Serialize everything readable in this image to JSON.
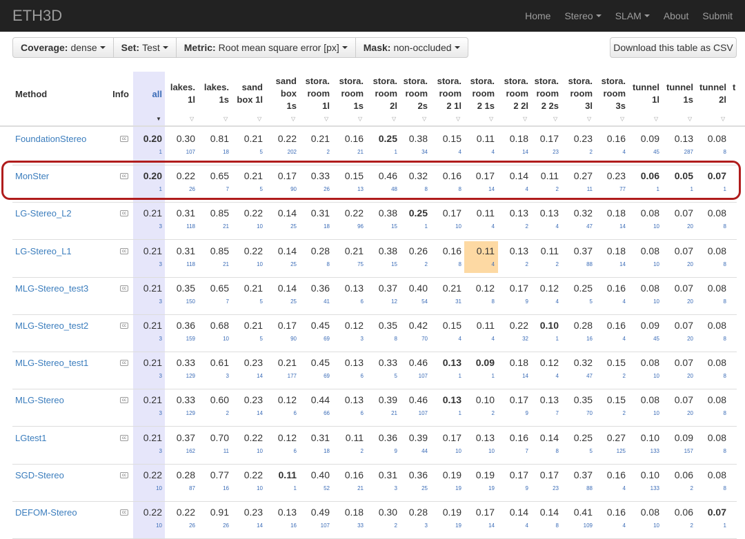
{
  "app": {
    "brand": "ETH3D"
  },
  "nav": [
    {
      "label": "Home",
      "dropdown": false
    },
    {
      "label": "Stereo",
      "dropdown": true
    },
    {
      "label": "SLAM",
      "dropdown": true
    },
    {
      "label": "About",
      "dropdown": false
    },
    {
      "label": "Submit",
      "dropdown": false
    }
  ],
  "filters": [
    {
      "key": "Coverage:",
      "value": "dense"
    },
    {
      "key": "Set:",
      "value": "Test"
    },
    {
      "key": "Metric:",
      "value": "Root mean square error [px]"
    },
    {
      "key": "Mask:",
      "value": "non-occluded"
    }
  ],
  "csv_button": "Download this table as CSV",
  "columns": {
    "method": "Method",
    "info": "Info",
    "all": "all",
    "datasets": [
      "lakes.\n1l",
      "lakes.\n1s",
      "sand\nbox 1l",
      "sand\nbox\n1s",
      "stora.\nroom\n1l",
      "stora.\nroom\n1s",
      "stora.\nroom\n2l",
      "stora.\nroom\n2s",
      "stora.\nroom\n2 1l",
      "stora.\nroom\n2 1s",
      "stora.\nroom\n2 2l",
      "stora.\nroom\n2 2s",
      "stora.\nroom\n3l",
      "stora.\nroom\n3s",
      "tunnel\n1l",
      "tunnel\n1s",
      "tunnel\n2l",
      "t"
    ]
  },
  "info_icon": "cc",
  "colors": {
    "highlight": "#b01c1c",
    "all_column": "#e6e6fa",
    "best_cell": "#fdd9a3",
    "link": "#3b7dbd"
  },
  "rows": [
    {
      "method": "FoundationStereo",
      "all": "0.20",
      "all_rank": "1",
      "all_bold": true,
      "vals": [
        "0.30",
        "0.81",
        "0.21",
        "0.22",
        "0.21",
        "0.16",
        "0.25",
        "0.38",
        "0.15",
        "0.11",
        "0.18",
        "0.17",
        "0.23",
        "0.16",
        "0.09",
        "0.13",
        "0.08"
      ],
      "ranks": [
        "107",
        "18",
        "5",
        "202",
        "2",
        "21",
        "1",
        "34",
        "4",
        "4",
        "14",
        "23",
        "2",
        "4",
        "45",
        "287",
        "8"
      ],
      "bold": [
        6
      ]
    },
    {
      "method": "MonSter",
      "all": "0.20",
      "all_rank": "1",
      "all_bold": true,
      "vals": [
        "0.22",
        "0.65",
        "0.21",
        "0.17",
        "0.33",
        "0.15",
        "0.46",
        "0.32",
        "0.16",
        "0.17",
        "0.14",
        "0.11",
        "0.27",
        "0.23",
        "0.06",
        "0.05",
        "0.07"
      ],
      "ranks": [
        "26",
        "7",
        "5",
        "90",
        "26",
        "13",
        "48",
        "8",
        "8",
        "14",
        "4",
        "2",
        "11",
        "77",
        "1",
        "1",
        "1"
      ],
      "bold": [
        14,
        15,
        16
      ]
    },
    {
      "method": "LG-Stereo_L2",
      "all": "0.21",
      "all_rank": "3",
      "all_bold": false,
      "vals": [
        "0.31",
        "0.85",
        "0.22",
        "0.14",
        "0.31",
        "0.22",
        "0.38",
        "0.25",
        "0.17",
        "0.11",
        "0.13",
        "0.13",
        "0.32",
        "0.18",
        "0.08",
        "0.07",
        "0.08"
      ],
      "ranks": [
        "118",
        "21",
        "10",
        "25",
        "18",
        "96",
        "15",
        "1",
        "10",
        "4",
        "2",
        "4",
        "47",
        "14",
        "10",
        "20",
        "8"
      ],
      "bold": [
        7
      ]
    },
    {
      "method": "LG-Stereo_L1",
      "all": "0.21",
      "all_rank": "3",
      "all_bold": false,
      "vals": [
        "0.31",
        "0.85",
        "0.22",
        "0.14",
        "0.28",
        "0.21",
        "0.38",
        "0.26",
        "0.16",
        "0.11",
        "0.13",
        "0.11",
        "0.37",
        "0.18",
        "0.08",
        "0.07",
        "0.08"
      ],
      "ranks": [
        "118",
        "21",
        "10",
        "25",
        "8",
        "75",
        "15",
        "2",
        "8",
        "4",
        "2",
        "2",
        "88",
        "14",
        "10",
        "20",
        "8"
      ],
      "bold": []
    },
    {
      "method": "MLG-Stereo_test3",
      "all": "0.21",
      "all_rank": "3",
      "all_bold": false,
      "vals": [
        "0.35",
        "0.65",
        "0.21",
        "0.14",
        "0.36",
        "0.13",
        "0.37",
        "0.40",
        "0.21",
        "0.12",
        "0.17",
        "0.12",
        "0.25",
        "0.16",
        "0.08",
        "0.07",
        "0.08"
      ],
      "ranks": [
        "150",
        "7",
        "5",
        "25",
        "41",
        "6",
        "12",
        "54",
        "31",
        "8",
        "9",
        "4",
        "5",
        "4",
        "10",
        "20",
        "8"
      ],
      "bold": []
    },
    {
      "method": "MLG-Stereo_test2",
      "all": "0.21",
      "all_rank": "3",
      "all_bold": false,
      "vals": [
        "0.36",
        "0.68",
        "0.21",
        "0.17",
        "0.45",
        "0.12",
        "0.35",
        "0.42",
        "0.15",
        "0.11",
        "0.22",
        "0.10",
        "0.28",
        "0.16",
        "0.09",
        "0.07",
        "0.08"
      ],
      "ranks": [
        "159",
        "10",
        "5",
        "90",
        "69",
        "3",
        "8",
        "70",
        "4",
        "4",
        "32",
        "1",
        "16",
        "4",
        "45",
        "20",
        "8"
      ],
      "bold": [
        11
      ]
    },
    {
      "method": "MLG-Stereo_test1",
      "all": "0.21",
      "all_rank": "3",
      "all_bold": false,
      "vals": [
        "0.33",
        "0.61",
        "0.23",
        "0.21",
        "0.45",
        "0.13",
        "0.33",
        "0.46",
        "0.13",
        "0.09",
        "0.18",
        "0.12",
        "0.32",
        "0.15",
        "0.08",
        "0.07",
        "0.08"
      ],
      "ranks": [
        "129",
        "3",
        "14",
        "177",
        "69",
        "6",
        "5",
        "107",
        "1",
        "1",
        "14",
        "4",
        "47",
        "2",
        "10",
        "20",
        "8"
      ],
      "bold": [
        8,
        9
      ]
    },
    {
      "method": "MLG-Stereo",
      "all": "0.21",
      "all_rank": "3",
      "all_bold": false,
      "vals": [
        "0.33",
        "0.60",
        "0.23",
        "0.12",
        "0.44",
        "0.13",
        "0.39",
        "0.46",
        "0.13",
        "0.10",
        "0.17",
        "0.13",
        "0.35",
        "0.15",
        "0.08",
        "0.07",
        "0.08"
      ],
      "ranks": [
        "129",
        "2",
        "14",
        "6",
        "66",
        "6",
        "21",
        "107",
        "1",
        "2",
        "9",
        "7",
        "70",
        "2",
        "10",
        "20",
        "8"
      ],
      "bold": [
        8
      ]
    },
    {
      "method": "LGtest1",
      "all": "0.21",
      "all_rank": "3",
      "all_bold": false,
      "vals": [
        "0.37",
        "0.70",
        "0.22",
        "0.12",
        "0.31",
        "0.11",
        "0.36",
        "0.39",
        "0.17",
        "0.13",
        "0.16",
        "0.14",
        "0.25",
        "0.27",
        "0.10",
        "0.09",
        "0.08"
      ],
      "ranks": [
        "162",
        "11",
        "10",
        "6",
        "18",
        "2",
        "9",
        "44",
        "10",
        "10",
        "7",
        "8",
        "5",
        "125",
        "133",
        "157",
        "8"
      ],
      "bold": []
    },
    {
      "method": "SGD-Stereo",
      "all": "0.22",
      "all_rank": "10",
      "all_bold": false,
      "vals": [
        "0.28",
        "0.77",
        "0.22",
        "0.11",
        "0.40",
        "0.16",
        "0.31",
        "0.36",
        "0.19",
        "0.19",
        "0.17",
        "0.17",
        "0.37",
        "0.16",
        "0.10",
        "0.06",
        "0.08"
      ],
      "ranks": [
        "87",
        "16",
        "10",
        "1",
        "52",
        "21",
        "3",
        "25",
        "19",
        "19",
        "9",
        "23",
        "88",
        "4",
        "133",
        "2",
        "8"
      ],
      "bold": [
        3
      ]
    },
    {
      "method": "DEFOM-Stereo",
      "all": "0.22",
      "all_rank": "10",
      "all_bold": false,
      "vals": [
        "0.22",
        "0.91",
        "0.23",
        "0.13",
        "0.49",
        "0.18",
        "0.30",
        "0.28",
        "0.19",
        "0.17",
        "0.14",
        "0.14",
        "0.41",
        "0.16",
        "0.08",
        "0.06",
        "0.07"
      ],
      "ranks": [
        "26",
        "26",
        "14",
        "16",
        "107",
        "33",
        "2",
        "3",
        "19",
        "14",
        "4",
        "8",
        "109",
        "4",
        "10",
        "2",
        "1"
      ],
      "bold": [
        16
      ]
    }
  ]
}
